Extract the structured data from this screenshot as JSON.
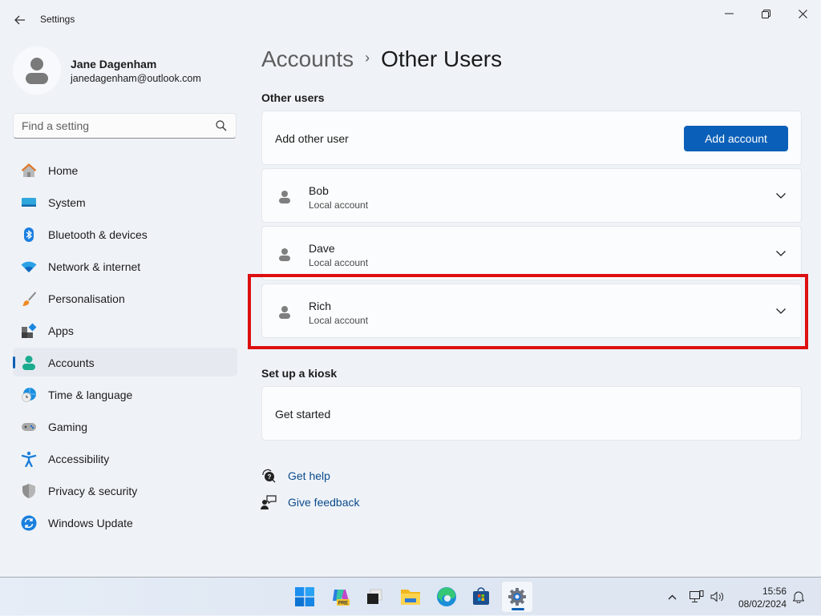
{
  "window": {
    "title": "Settings",
    "back_icon": "arrow-left-icon",
    "controls": {
      "minimize": "minimize-icon",
      "maximize": "restore-icon",
      "close": "close-icon"
    }
  },
  "profile": {
    "name": "Jane Dagenham",
    "email": "janedagenham@outlook.com",
    "avatar_icon": "person-icon"
  },
  "search": {
    "placeholder": "Find a setting",
    "value": "",
    "icon": "search-icon"
  },
  "sidebar": {
    "active": "Accounts",
    "items": [
      {
        "label": "Home",
        "icon": "home-icon"
      },
      {
        "label": "System",
        "icon": "system-icon"
      },
      {
        "label": "Bluetooth & devices",
        "icon": "bluetooth-icon"
      },
      {
        "label": "Network & internet",
        "icon": "wifi-icon"
      },
      {
        "label": "Personalisation",
        "icon": "brush-icon"
      },
      {
        "label": "Apps",
        "icon": "apps-icon"
      },
      {
        "label": "Accounts",
        "icon": "accounts-icon"
      },
      {
        "label": "Time & language",
        "icon": "globe-clock-icon"
      },
      {
        "label": "Gaming",
        "icon": "gamepad-icon"
      },
      {
        "label": "Accessibility",
        "icon": "accessibility-icon"
      },
      {
        "label": "Privacy & security",
        "icon": "shield-icon"
      },
      {
        "label": "Windows Update",
        "icon": "update-icon"
      }
    ]
  },
  "main": {
    "breadcrumb": {
      "parent": "Accounts",
      "separator": "›",
      "current": "Other Users"
    },
    "other_users": {
      "heading": "Other users",
      "add_label": "Add other user",
      "add_button": "Add account",
      "users": [
        {
          "name": "Bob",
          "type": "Local account"
        },
        {
          "name": "Dave",
          "type": "Local account"
        },
        {
          "name": "Rich",
          "type": "Local account",
          "highlighted": true
        }
      ]
    },
    "kiosk": {
      "heading": "Set up a kiosk",
      "label": "Get started"
    },
    "links": [
      {
        "label": "Get help",
        "icon": "help-icon"
      },
      {
        "label": "Give feedback",
        "icon": "feedback-icon"
      }
    ]
  },
  "colors": {
    "accent": "#0a5fb8",
    "highlight": "#dd0f0f",
    "link": "#0b4a8b"
  },
  "taskbar": {
    "apps": [
      {
        "name": "Start",
        "icon": "windows-start-icon"
      },
      {
        "name": "Copilot",
        "icon": "copilot-icon",
        "badge": "PRE"
      },
      {
        "name": "Task View",
        "icon": "task-view-icon"
      },
      {
        "name": "File Explorer",
        "icon": "folder-icon"
      },
      {
        "name": "Microsoft Edge",
        "icon": "edge-icon"
      },
      {
        "name": "Microsoft Store",
        "icon": "store-icon"
      },
      {
        "name": "Settings",
        "icon": "gear-icon",
        "active": true
      }
    ],
    "tray": {
      "chevron": "chevron-up-icon",
      "network": "network-icon",
      "volume": "volume-icon",
      "notifications": "bell-icon"
    },
    "time": "15:56",
    "date": "08/02/2024"
  }
}
